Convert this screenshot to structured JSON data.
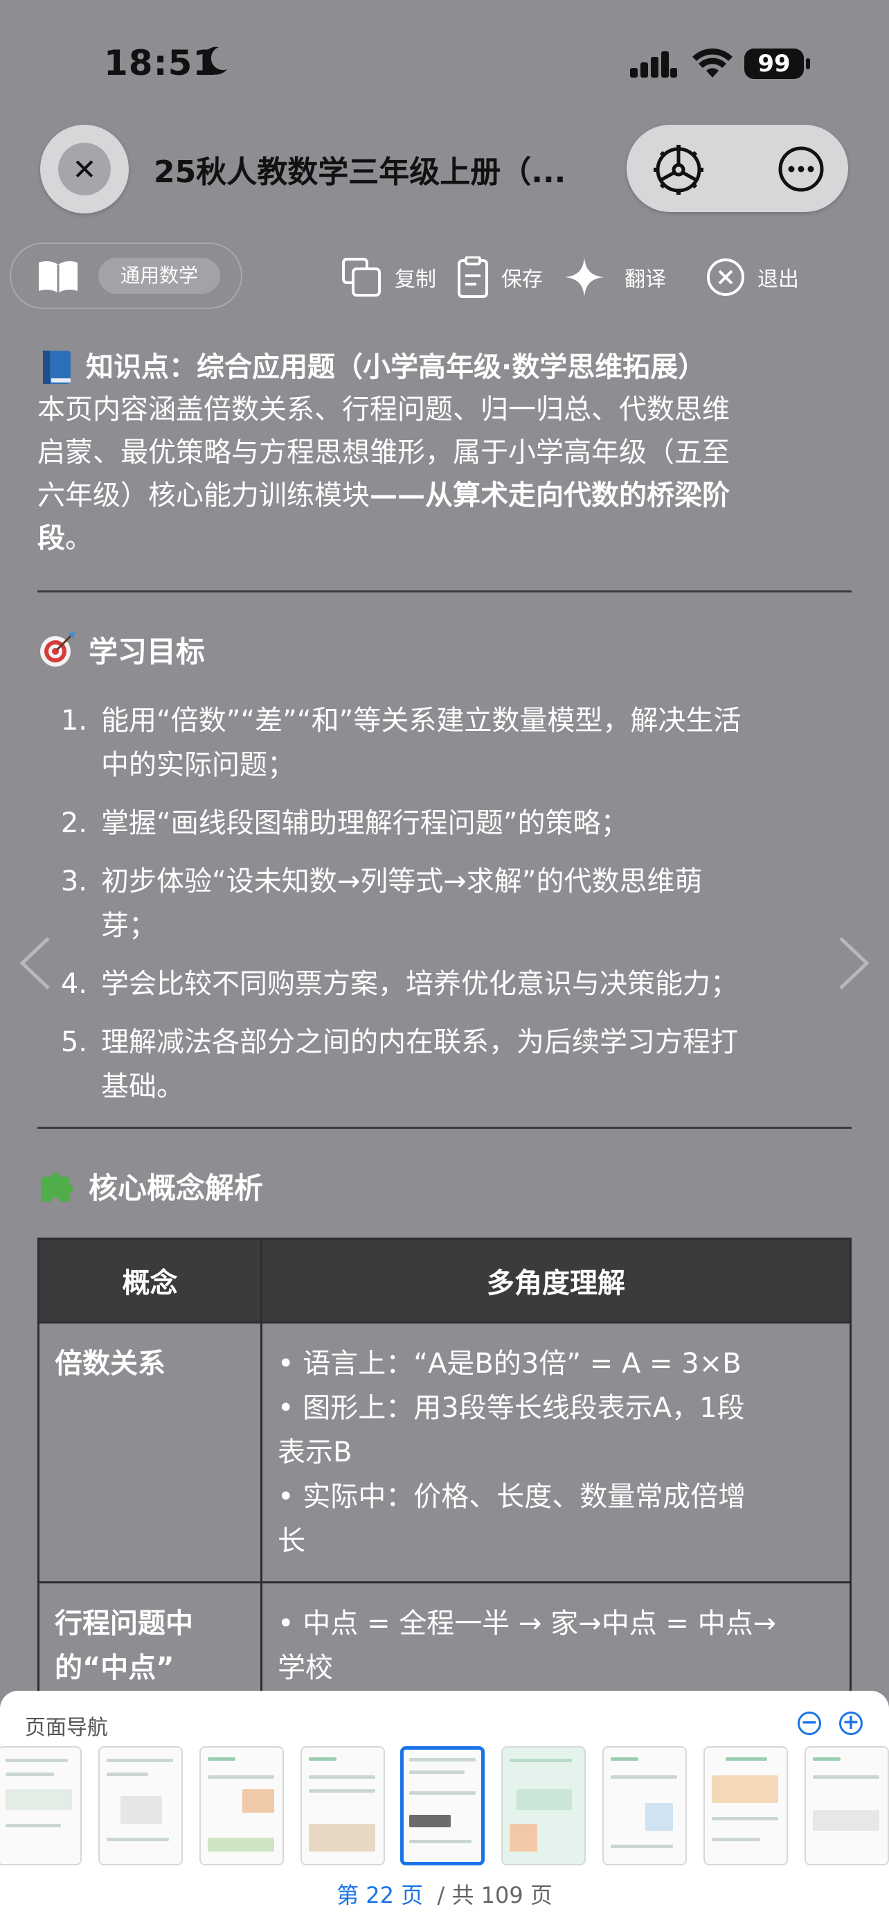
{
  "status_bar": {
    "time": "18:51",
    "battery": "99"
  },
  "header": {
    "title": "25秋人教数学三年级上册（...",
    "close_icon": "close-icon",
    "settings_icon": "gear-icon",
    "more_icon": "more-icon"
  },
  "toolbar": {
    "mode_tag": "通用数学",
    "copy": "复制",
    "save": "保存",
    "translate": "翻译",
    "exit": "退出"
  },
  "knowledge": {
    "heading": "知识点：综合应用题（小学高年级·数学思维拓展）",
    "lines": [
      "本页内容涵盖倍数关系、行程问题、归一归总、代数思维",
      "启蒙、最优策略与方程思想雏形，属于小学高年级（五至",
      "六年级）核心能力训练模块"
    ],
    "emphasis_1": "——从算术走向代数的桥梁阶",
    "emphasis_2": "段",
    "tail": "。"
  },
  "goals": {
    "title": "学习目标",
    "items": [
      {
        "num": "1.",
        "lines": [
          "能用“倍数”“差”“和”等关系建立数量模型，解决生活",
          "中的实际问题；"
        ]
      },
      {
        "num": "2.",
        "lines": [
          "掌握“画线段图辅助理解行程问题”的策略；"
        ]
      },
      {
        "num": "3.",
        "lines": [
          "初步体验“设未知数→列等式→求解”的代数思维萌",
          "芽；"
        ]
      },
      {
        "num": "4.",
        "lines": [
          "学会比较不同购票方案，培养优化意识与决策能力；"
        ]
      },
      {
        "num": "5.",
        "lines": [
          "理解减法各部分之间的内在联系，为后续学习方程打",
          "基础。"
        ]
      }
    ]
  },
  "concepts": {
    "title": "核心概念解析",
    "headers": [
      "概念",
      "多角度理解"
    ],
    "rows": [
      {
        "name": "倍数关系",
        "lines": [
          "• 语言上：“A是B的3倍” = A = 3×B",
          "• 图形上：用3段等长线段表示A，1段",
          "表示B",
          "• 实际中：价格、长度、数量常成倍增",
          "长"
        ]
      },
      {
        "name": "行程问题中",
        "name2": "的“中点”",
        "lines": [
          "• 中点 = 全程一半 → 家→中点 = 中点→",
          "学校"
        ]
      }
    ]
  },
  "page_nav": {
    "label": "页面导航",
    "current_prefix": "第",
    "current": "22",
    "current_suffix": "页",
    "total": "/ 共 109 页"
  }
}
